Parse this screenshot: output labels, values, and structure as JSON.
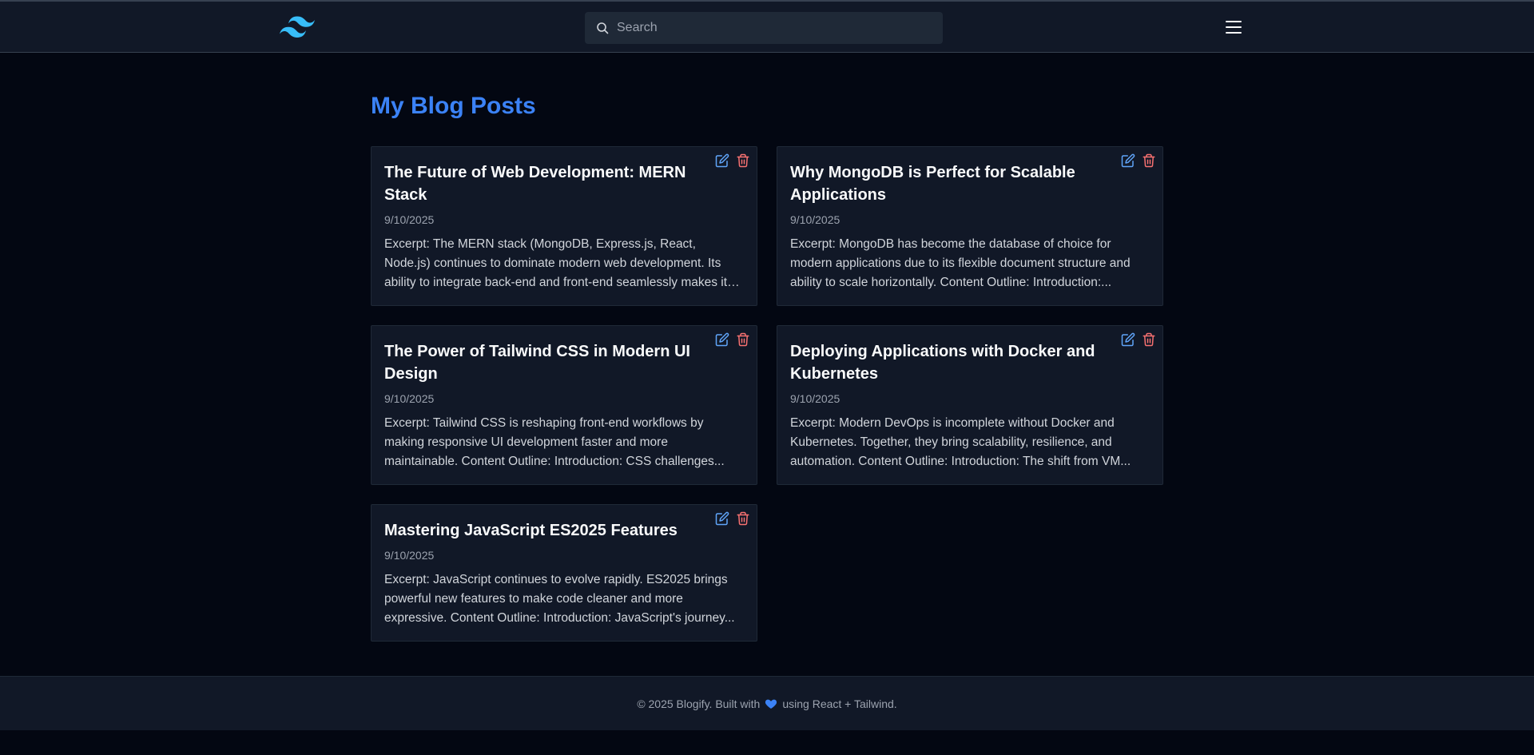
{
  "header": {
    "search_placeholder": "Search",
    "icons": {
      "logo": "tailwind-logo",
      "search": "search-icon",
      "menu": "hamburger-menu-icon"
    }
  },
  "main": {
    "title": "My Blog Posts",
    "posts": [
      {
        "title": "The Future of Web Development: MERN Stack",
        "date": "9/10/2025",
        "excerpt": "Excerpt: The MERN stack (MongoDB, Express.js, React, Node.js) continues to dominate modern web development. Its ability to integrate back-end and front-end seamlessly makes it an..."
      },
      {
        "title": "Why MongoDB is Perfect for Scalable Applications",
        "date": "9/10/2025",
        "excerpt": "Excerpt: MongoDB has become the database of choice for modern applications due to its flexible document structure and ability to scale horizontally. Content Outline: Introduction:..."
      },
      {
        "title": "The Power of Tailwind CSS in Modern UI Design",
        "date": "9/10/2025",
        "excerpt": "Excerpt: Tailwind CSS is reshaping front-end workflows by making responsive UI development faster and more maintainable. Content Outline: Introduction: CSS challenges..."
      },
      {
        "title": "Deploying Applications with Docker and Kubernetes",
        "date": "9/10/2025",
        "excerpt": "Excerpt: Modern DevOps is incomplete without Docker and Kubernetes. Together, they bring scalability, resilience, and automation. Content Outline: Introduction: The shift from VM..."
      },
      {
        "title": "Mastering JavaScript ES2025 Features",
        "date": "9/10/2025",
        "excerpt": "Excerpt: JavaScript continues to evolve rapidly. ES2025 brings powerful new features to make code cleaner and more expressive. Content Outline: Introduction: JavaScript's journey..."
      }
    ]
  },
  "footer": {
    "text_before": "© 2025 Blogify. Built with",
    "text_after": "using React + Tailwind.",
    "heart_icon": "blue-heart-icon"
  },
  "colors": {
    "background": "#030712",
    "surface": "#111827",
    "accent": "#3b82f6",
    "edit": "#60a5fa",
    "delete": "#f87171",
    "logo": "#38bdf8"
  }
}
